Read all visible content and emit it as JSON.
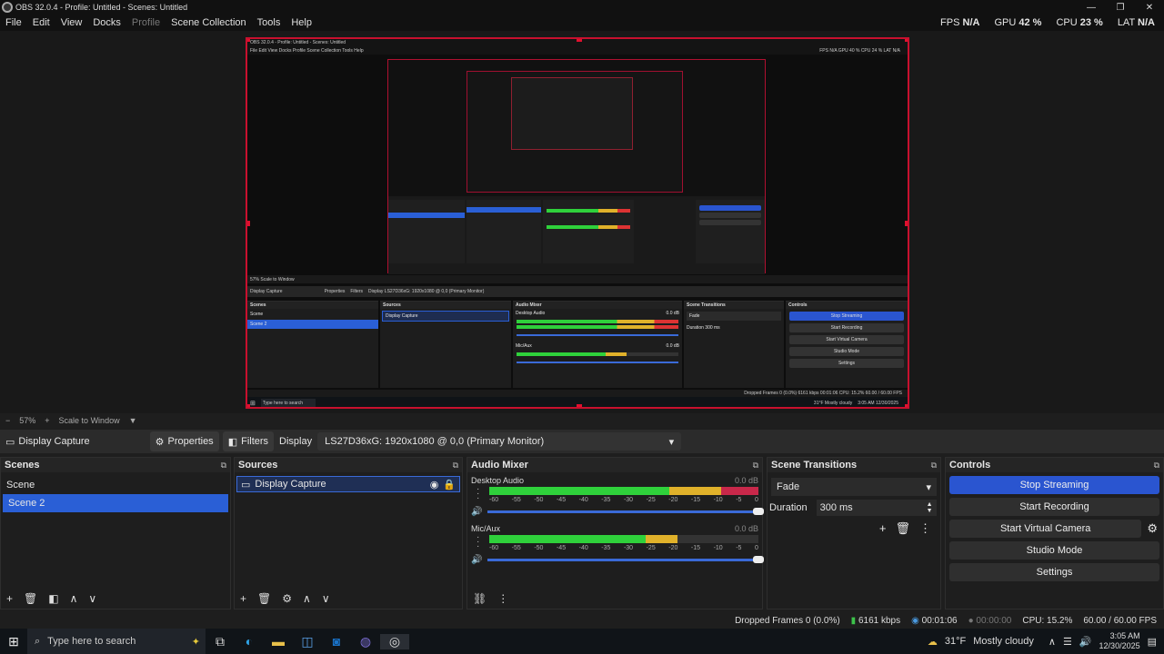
{
  "window": {
    "title": "OBS 32.0.4 - Profile: Untitled - Scenes: Untitled",
    "controls": [
      "—",
      "❐",
      "✕"
    ]
  },
  "menu": [
    {
      "label": "File",
      "dim": false
    },
    {
      "label": "Edit",
      "dim": false
    },
    {
      "label": "View",
      "dim": false
    },
    {
      "label": "Docks",
      "dim": false
    },
    {
      "label": "Profile",
      "dim": true
    },
    {
      "label": "Scene Collection",
      "dim": false
    },
    {
      "label": "Tools",
      "dim": false
    },
    {
      "label": "Help",
      "dim": false
    }
  ],
  "stats": {
    "fps_label": "FPS",
    "fps_value": "N/A",
    "gpu_label": "GPU",
    "gpu_value": "42 %",
    "cpu_label": "CPU",
    "cpu_value": "23 %",
    "lat_label": "LAT",
    "lat_value": "N/A"
  },
  "preview": {
    "nested_title": "OBS 32.0.4 - Profile: Untitled - Scenes: Untitled",
    "nested_menu": "File  Edit  View  Docks  Profile  Scene Collection  Tools  Help",
    "nested_stats": "FPS N/A   GPU 40 %   CPU 24 %   LAT N/A",
    "nested_scale": "57%   Scale to Window",
    "nested_source": "Display Capture",
    "nested_properties": "Properties",
    "nested_filters": "Filters",
    "nested_display": "Display   LS27D36xG: 1920x1080 @ 0,0 (Primary Monitor)",
    "nested_scenes_head": "Scenes",
    "nested_scene_1": "Scene",
    "nested_scene_2": "Scene 2",
    "nested_sources_head": "Sources",
    "nested_mixer_head": "Audio Mixer",
    "nested_desktop": "Desktop Audio",
    "nested_mic": "Mic/Aux",
    "nested_db": "0.0 dB",
    "nested_transitions_head": "Scene Transitions",
    "nested_fade": "Fade",
    "nested_duration": "Duration   300 ms",
    "nested_controls_head": "Controls",
    "nested_stop_streaming": "Stop Streaming",
    "nested_start_recording": "Start Recording",
    "nested_start_vc": "Start Virtual Camera",
    "nested_studio": "Studio Mode",
    "nested_settings": "Settings",
    "nested_status": "Dropped Frames 0 (0.0%)   6161 kbps   00:01:06   CPU: 15.2%   60.00 / 60.00 FPS",
    "nested_search": "Type here to search",
    "nested_weather": "31°F  Mostly cloudy",
    "nested_time": "3:05 AM",
    "nested_date": "12/30/2025"
  },
  "scale": {
    "zoom": "57%",
    "mode": "Scale to Window"
  },
  "source_toolbar": {
    "source_name": "Display Capture",
    "properties_label": "Properties",
    "filters_label": "Filters",
    "display_label": "Display",
    "display_value": "LS27D36xG: 1920x1080 @ 0,0 (Primary Monitor)"
  },
  "scenes": {
    "title": "Scenes",
    "items": [
      {
        "label": "Scene",
        "selected": false
      },
      {
        "label": "Scene 2",
        "selected": true
      }
    ]
  },
  "sources": {
    "title": "Sources",
    "items": [
      {
        "label": "Display Capture",
        "visible": true,
        "locked": false
      }
    ]
  },
  "mixer": {
    "title": "Audio Mixer",
    "ticks": [
      "-60",
      "-55",
      "-50",
      "-45",
      "-40",
      "-35",
      "-30",
      "-25",
      "-20",
      "-15",
      "-10",
      "-5",
      "0"
    ],
    "channels": [
      {
        "name": "Desktop Audio",
        "db": "0.0 dB",
        "level_green": 0.67,
        "level_yellow": 0.86,
        "level_red": 1.0
      },
      {
        "name": "Mic/Aux",
        "db": "0.0 dB",
        "level_green": 0.58,
        "level_yellow": 0.7,
        "level_red": 0.7
      }
    ]
  },
  "transitions": {
    "title": "Scene Transitions",
    "selected": "Fade",
    "duration_label": "Duration",
    "duration_value": "300 ms"
  },
  "controls": {
    "title": "Controls",
    "stop_streaming": "Stop Streaming",
    "start_recording": "Start Recording",
    "start_virtual_camera": "Start Virtual Camera",
    "studio_mode": "Studio Mode",
    "settings": "Settings"
  },
  "status": {
    "dropped_frames": "Dropped Frames 0 (0.0%)",
    "bitrate": "6161 kbps",
    "stream_time": "00:01:06",
    "record_time": "00:00:00",
    "cpu": "CPU: 15.2%",
    "fps": "60.00 / 60.00 FPS"
  },
  "taskbar": {
    "search_placeholder": "Type here to search",
    "weather": "31°F",
    "weather_desc": "Mostly cloudy",
    "time": "3:05 AM",
    "date": "12/30/2025"
  },
  "colors": {
    "accent": "#2a55d0",
    "selection": "#2a5fd6",
    "preview_border": "#c8102e",
    "meter_green": "#2fd13b",
    "meter_yellow": "#e0b12a",
    "meter_red": "#c8284a"
  }
}
